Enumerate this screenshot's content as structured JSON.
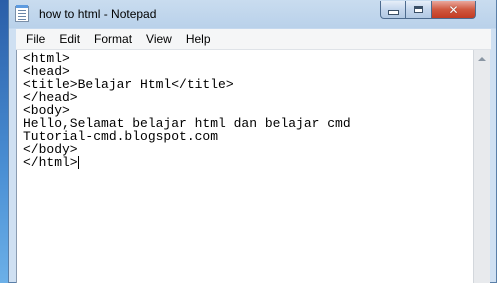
{
  "window": {
    "title": "how to html - Notepad",
    "icon": "notepad-icon"
  },
  "controls": {
    "minimize_icon": "minimize-icon",
    "maximize_icon": "maximize-icon",
    "close_icon": "close-icon",
    "close_glyph": "✕"
  },
  "menu": {
    "items": [
      {
        "label": "File"
      },
      {
        "label": "Edit"
      },
      {
        "label": "Format"
      },
      {
        "label": "View"
      },
      {
        "label": "Help"
      }
    ]
  },
  "editor": {
    "content": "<html>\n<head>\n<title>Belajar Html</title>\n</head>\n<body>\nHello,Selamat belajar html dan belajar cmd\nTutorial-cmd.blogspot.com\n</body>\n</html>"
  },
  "scrollbar": {
    "up_icon": "scroll-up-arrow-icon"
  },
  "colors": {
    "close_button": "#c23b23",
    "titlebar": "#c9dcef",
    "menubar": "#f5f6f7",
    "editor_background": "#ffffff"
  }
}
